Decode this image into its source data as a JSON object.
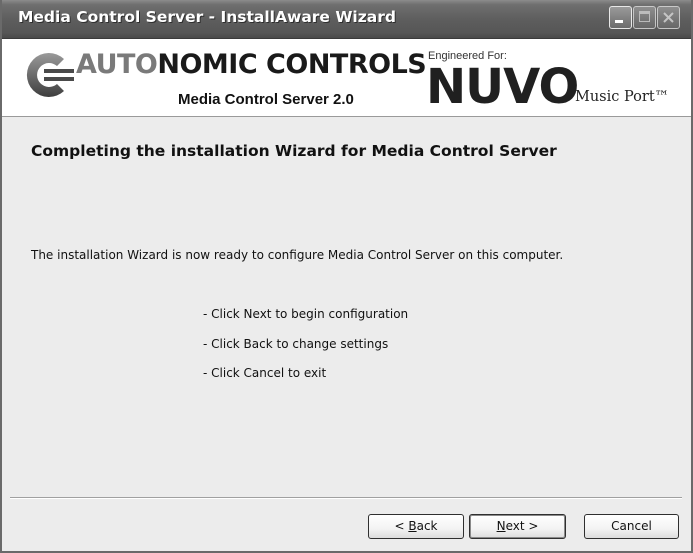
{
  "window": {
    "title": "Media Control Server - InstallAware Wizard",
    "controls": {
      "minimize_icon": "minimize-icon",
      "maximize_icon": "maximize-icon",
      "close_icon": "close-icon"
    }
  },
  "banner": {
    "brand_prefix": "AUTO",
    "brand_suffix": "NOMIC CONTROLS",
    "product": "Media Control Server 2.0",
    "engineered_for": "Engineered For:",
    "partner_logo": "NUVO",
    "partner_product": "Music Port™"
  },
  "content": {
    "heading": "Completing the installation Wizard for Media Control Server",
    "intro": "The installation Wizard is now ready to configure Media Control Server on this computer.",
    "instructions": [
      "- Click Next to begin configuration",
      "- Click Back to change settings",
      "- Click Cancel to exit"
    ]
  },
  "buttons": {
    "back": {
      "label": "< Back",
      "mnemonic": "B"
    },
    "next": {
      "label": "Next >",
      "mnemonic": "N"
    },
    "cancel": {
      "label": "Cancel"
    }
  },
  "colors": {
    "titlebar": "#5e5e5e",
    "dialog_bg": "#ececec",
    "banner_bg": "#ffffff"
  }
}
